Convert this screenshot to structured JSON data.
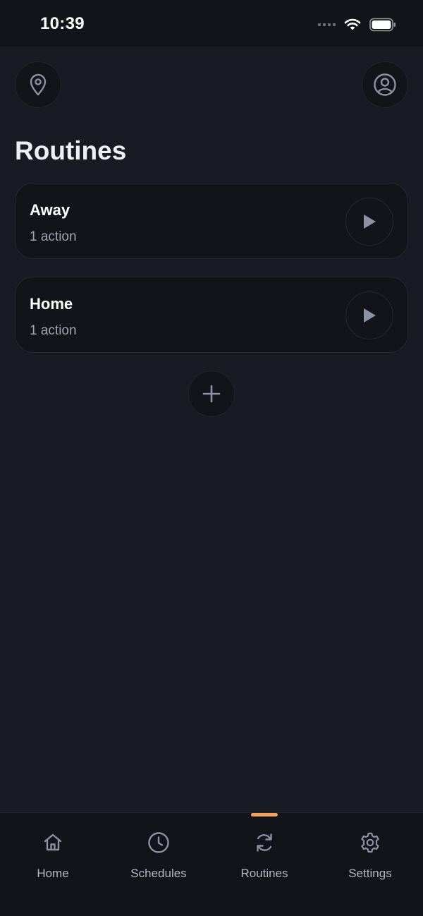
{
  "status_bar": {
    "time": "10:39",
    "icons": [
      "signal-dots-icon",
      "wifi-icon",
      "battery-icon"
    ]
  },
  "header": {
    "left_icon": "location-pin-icon",
    "right_icon": "user-circle-icon"
  },
  "page": {
    "title": "Routines"
  },
  "routines": [
    {
      "name": "Away",
      "count": "1 action",
      "action_icon": "play-icon"
    },
    {
      "name": "Home",
      "count": "1 action",
      "action_icon": "play-icon"
    }
  ],
  "add_button": {
    "icon": "plus-icon"
  },
  "tabs": [
    {
      "label": "Home",
      "icon": "home-icon",
      "active": false
    },
    {
      "label": "Schedules",
      "icon": "clock-icon",
      "active": false
    },
    {
      "label": "Routines",
      "icon": "refresh-icon",
      "active": true
    },
    {
      "label": "Settings",
      "icon": "gear-icon",
      "active": false
    }
  ],
  "colors": {
    "background": "#181b23",
    "surface": "#12141a",
    "accent": "#f0a15b",
    "icon": "#8e90a6",
    "text_secondary": "#a2a5b0"
  }
}
